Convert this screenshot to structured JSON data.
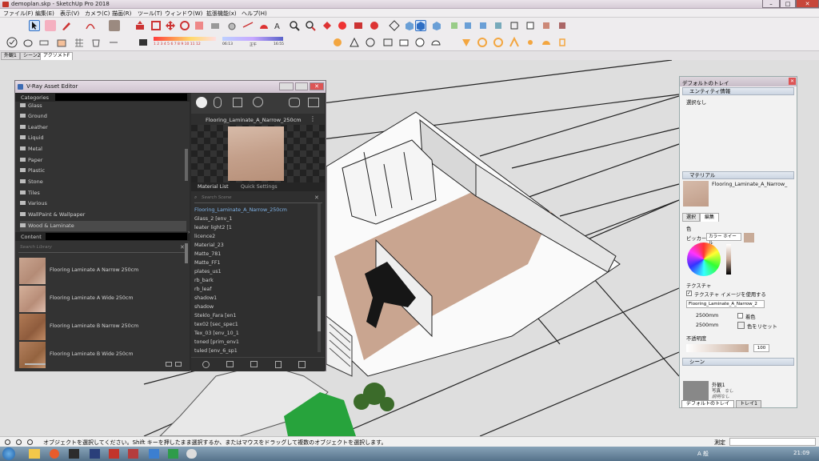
{
  "window": {
    "title": "demoplan.skp - SketchUp Pro 2018"
  },
  "menu": [
    "ファイル(F)",
    "編集(E)",
    "表示(V)",
    "カメラ(C)",
    "描画(R)",
    "ツール(T)",
    "ウィンドウ(W)",
    "拡張機能(x)",
    "ヘルプ(H)"
  ],
  "shadow_slider": {
    "numbers": "1 2 3 4 5 6 7 8 9 10 11 12",
    "time_start": "06:13",
    "time_mid": "正午",
    "time_end": "16:55"
  },
  "scene_tabs": [
    "外観1",
    "シーン2",
    "アクソメトF"
  ],
  "vray": {
    "title": "V-Ray Asset Editor",
    "categories_label": "Categories",
    "categories": [
      "Glass",
      "Ground",
      "Leather",
      "Liquid",
      "Metal",
      "Paper",
      "Plastic",
      "Stone",
      "Tiles",
      "Various",
      "WallPaint & Wallpaper",
      "Wood & Laminate"
    ],
    "selected_category": "Wood & Laminate",
    "content_label": "Content",
    "search_library": "Search Library",
    "library": [
      "Flooring Laminate A Narrow 250cm",
      "Flooring Laminate A Wide 250cm",
      "Flooring Laminate B Narrow 250cm",
      "Flooring Laminate B Wide 250cm"
    ],
    "material_name": "Flooring_Laminate_A_Narrow_250cm",
    "tab_material_list": "Material List",
    "tab_quick_settings": "Quick Settings",
    "search_scene": "Search Scene",
    "scene_materials": [
      "Flooring_Laminate_A_Narrow_250cm",
      "Glass_2 [env_1",
      "leater light2 [1",
      "licence2",
      "Material_23",
      "Matte_781",
      "Matte_FF1",
      "plates_us1",
      "rb_bark",
      "rb_leaf",
      "shadow1",
      "shadow",
      "Steklo_Fara [en1",
      "tex02 [sec_spec1",
      "Tex_03 [env_10_1",
      "toned [prim_env1",
      "tuled [env_6_sp1"
    ]
  },
  "tray": {
    "title": "デフォルトのトレイ",
    "entity_info": "エンティティ情報",
    "no_selection": "選択なし",
    "materials": "マテリアル",
    "material_name": "Flooring_Laminate_A_Narrow_",
    "tab_select": "選択",
    "tab_edit": "編集",
    "color_label": "色",
    "picker_label": "ピッカー:",
    "picker_value": "カラー ホイール",
    "texture_label": "テクスチャ",
    "use_texture": "テクスチャ イメージを使用する",
    "texture_file": "Flooring_Laminate_A_Narrow_2",
    "width": "2500mm",
    "height": "2500mm",
    "colorize": "着色",
    "reset_color": "色をリセット",
    "opacity_label": "不透明度",
    "opacity_value": "100",
    "scenes": "シーン",
    "scene_name": "外観1",
    "scene_photo": "写真",
    "scene_photo_val": "なし",
    "scene_desc": "説明なし",
    "footer_tab1": "デフォルトのトレイ",
    "footer_tab2": "トレイ1"
  },
  "status": {
    "message": "オブジェクトを選択してください。Shift キーを押したまま選択するか、またはマウスをドラッグして複数のオブジェクトを選択します。",
    "measure": "測定"
  },
  "taskbar": {
    "time": "21:09",
    "ime": "A 般"
  },
  "colors": {
    "vray_bg": "#2b2b2b",
    "accent": "#2e6ec4",
    "floor": "#c9a590",
    "viewport": "#dedede"
  }
}
